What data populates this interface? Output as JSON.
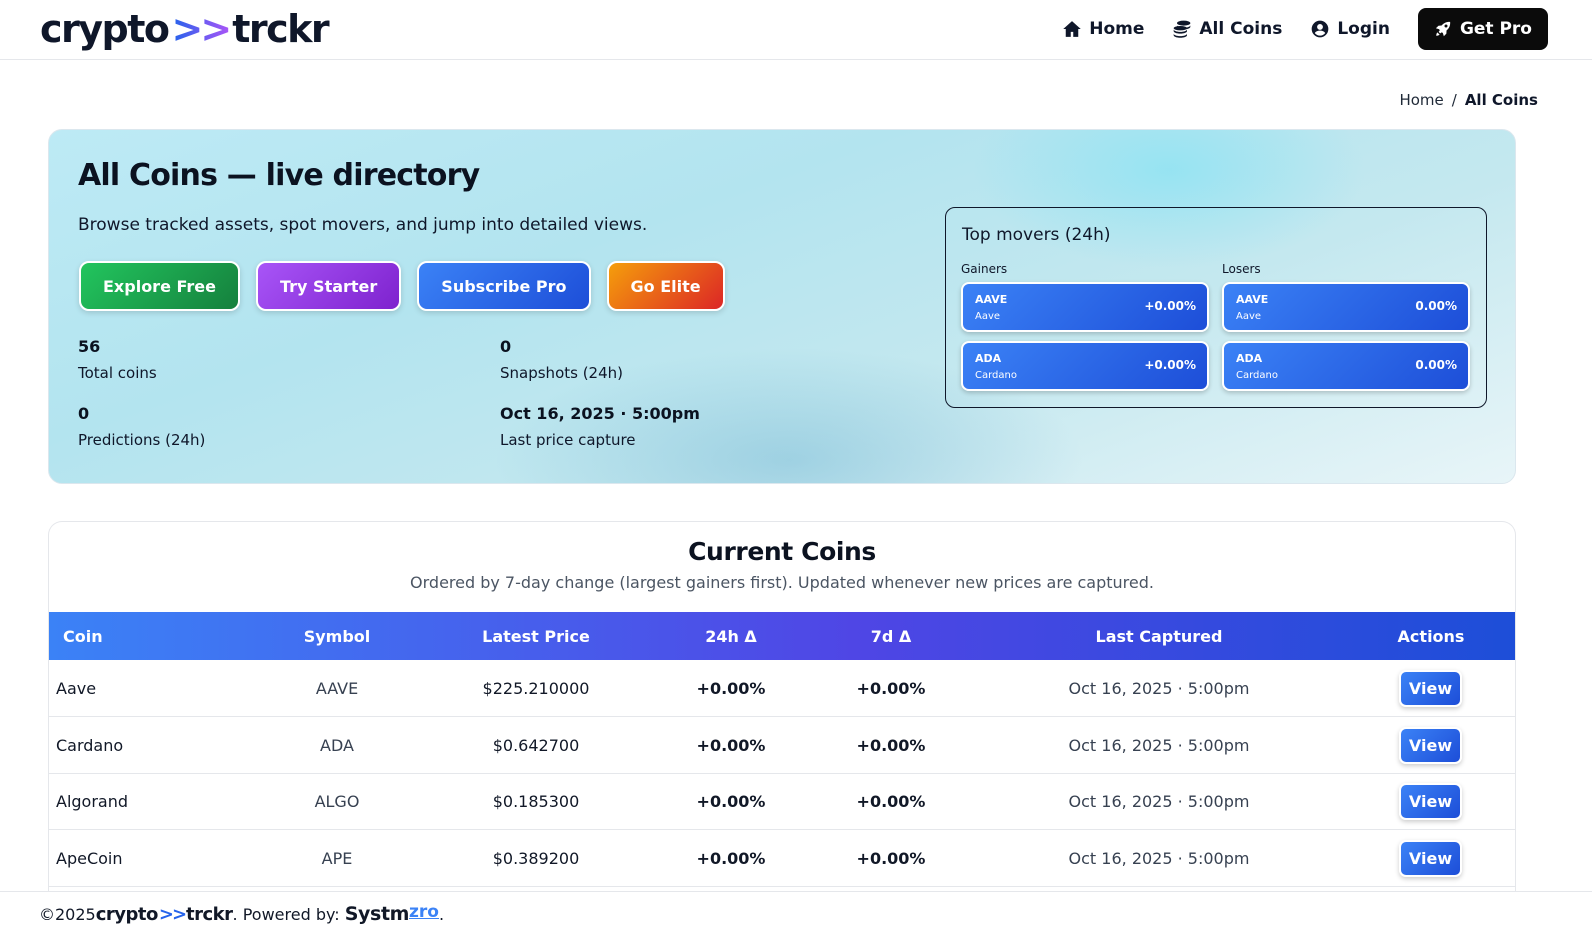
{
  "nav": {
    "logo_left": "crypto",
    "logo_arrows": ">>",
    "logo_right": "trckr",
    "links": [
      {
        "label": "Home",
        "icon": "home-icon"
      },
      {
        "label": "All Coins",
        "icon": "coins-icon"
      },
      {
        "label": "Login",
        "icon": "user-circle-icon"
      }
    ],
    "cta_label": "Get Pro",
    "cta_icon": "rocket-icon"
  },
  "breadcrumb": {
    "home": "Home",
    "separator": "/",
    "current": "All Coins"
  },
  "hero": {
    "title": "All Coins — live directory",
    "subtitle": "Browse tracked assets, spot movers, and jump into detailed views.",
    "buttons": [
      {
        "label": "Explore Free",
        "color": "#16a34a"
      },
      {
        "label": "Try Starter",
        "color": "#9333ea"
      },
      {
        "label": "Subscribe Pro",
        "color": "#2563eb"
      },
      {
        "label": "Go Elite",
        "color": "#ea580c"
      }
    ],
    "stats": [
      {
        "value": "56",
        "label": "Total coins"
      },
      {
        "value": "0",
        "label": "Snapshots (24h)"
      },
      {
        "value": "0",
        "label": "Predictions (24h)"
      },
      {
        "value": "Oct 16, 2025 · 5:00pm",
        "label": "Last price capture"
      }
    ]
  },
  "movers": {
    "title": "Top movers (24h)",
    "gainers_label": "Gainers",
    "losers_label": "Losers",
    "gainers": [
      {
        "symbol": "AAVE",
        "name": "Aave",
        "change": "+0.00%"
      },
      {
        "symbol": "ADA",
        "name": "Cardano",
        "change": "+0.00%"
      }
    ],
    "losers": [
      {
        "symbol": "AAVE",
        "name": "Aave",
        "change": "0.00%"
      },
      {
        "symbol": "ADA",
        "name": "Cardano",
        "change": "0.00%"
      }
    ]
  },
  "table": {
    "title": "Current Coins",
    "subtitle": "Ordered by 7-day change (largest gainers first). Updated whenever new prices are captured.",
    "headers": [
      "Coin",
      "Symbol",
      "Latest Price",
      "24h Δ",
      "7d Δ",
      "Last Captured",
      "Actions"
    ],
    "view_label": "View",
    "rows": [
      {
        "coin": "Aave",
        "symbol": "AAVE",
        "price": "$225.210000",
        "change_24h": "+0.00%",
        "change_7d": "+0.00%",
        "captured": "Oct 16, 2025 · 5:00pm"
      },
      {
        "coin": "Cardano",
        "symbol": "ADA",
        "price": "$0.642700",
        "change_24h": "+0.00%",
        "change_7d": "+0.00%",
        "captured": "Oct 16, 2025 · 5:00pm"
      },
      {
        "coin": "Algorand",
        "symbol": "ALGO",
        "price": "$0.185300",
        "change_24h": "+0.00%",
        "change_7d": "+0.00%",
        "captured": "Oct 16, 2025 · 5:00pm"
      },
      {
        "coin": "ApeCoin",
        "symbol": "APE",
        "price": "$0.389200",
        "change_24h": "+0.00%",
        "change_7d": "+0.00%",
        "captured": "Oct 16, 2025 · 5:00pm"
      }
    ]
  },
  "footer": {
    "copyright": "©2025",
    "brand_left": "crypto",
    "brand_arrows": ">>",
    "brand_right": "trckr",
    "powered_by": ". Powered by:",
    "systm": "Systm",
    "zro": "zro",
    "end": "."
  }
}
